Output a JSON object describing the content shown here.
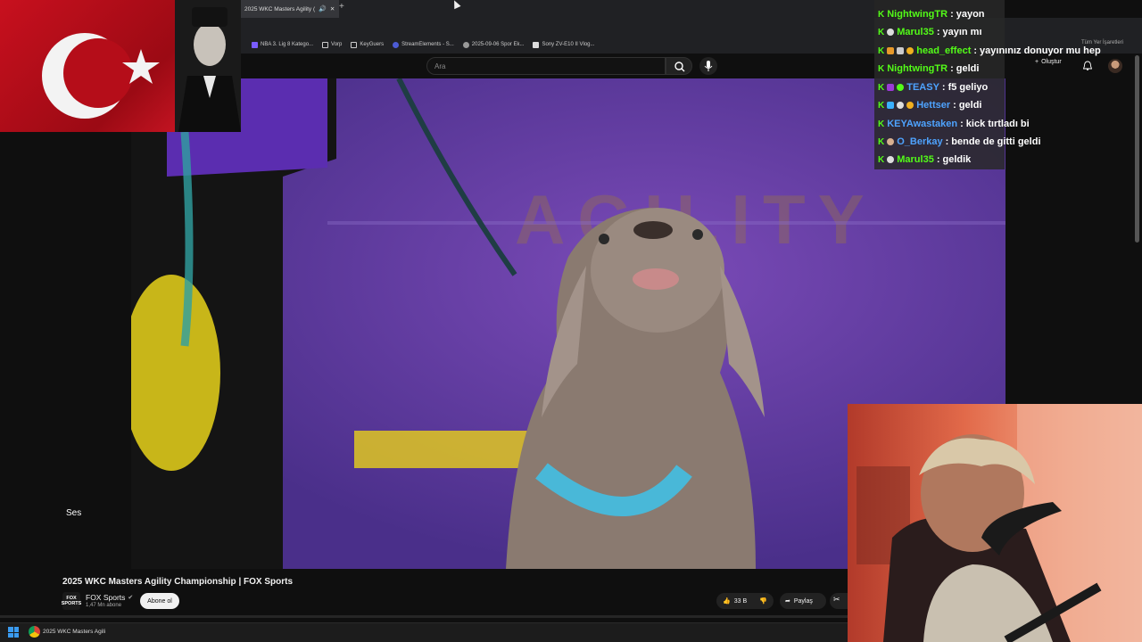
{
  "browser": {
    "tab_title": "2025 WKC Masters Agility (",
    "new_tab": "+",
    "bookmarks": [
      {
        "label": "NBA 3. Lig 8 Katego...",
        "icon": "bookmark-icon"
      },
      {
        "label": "Vorp",
        "icon": "folder-icon"
      },
      {
        "label": "KeyGuers",
        "icon": "folder-icon"
      },
      {
        "label": "StreamElements - S...",
        "icon": "streamelements-icon"
      },
      {
        "label": "2025-09-06 Spor Ek...",
        "icon": "bookmark-icon"
      },
      {
        "label": "Sony ZV-E10 II Vlog...",
        "icon": "bookmark-icon"
      }
    ],
    "all_bookmarks": "Tüm Yer İşaretleri"
  },
  "youtube": {
    "search_placeholder": "Ara",
    "create_label": "Oluştur",
    "volume_label": "Ses",
    "video_title": "2025 WKC Masters Agility Championship | FOX Sports",
    "channel_logo_text": "FOX SPORTS",
    "channel_name": "FOX Sports",
    "subscriber_count": "1,47 Mn abone",
    "subscribe_label": "Abone ol",
    "like_count": "33 B",
    "share_label": "Paylaş",
    "arena_text": "AGILITY"
  },
  "chat": {
    "messages": [
      {
        "user": "NightwingTR",
        "text": "yayon",
        "color": "#53fc18"
      },
      {
        "user": "Marul35",
        "text": "yayın mı",
        "color": "#53fc18"
      },
      {
        "user": "head_effect",
        "text": "yayınınız donuyor mu hep",
        "color": "#53fc18"
      },
      {
        "user": "NightwingTR",
        "text": "geldi",
        "color": "#53fc18"
      },
      {
        "user": "TEASY",
        "text": "f5 geliyo",
        "color": "#4ea3ff"
      },
      {
        "user": "Hettser",
        "text": "geldi",
        "color": "#4ea3ff"
      },
      {
        "user": "KEYAwastaken",
        "text": "kick tırtladı bi",
        "color": "#4ea3ff"
      },
      {
        "user": "O_Berkay",
        "text": "bende de gitti geldi",
        "color": "#4ea3ff"
      },
      {
        "user": "Marul35",
        "text": "geldik",
        "color": "#53fc18"
      }
    ]
  },
  "taskbar": {
    "app_label": "2025 WKC Masters Agili"
  }
}
